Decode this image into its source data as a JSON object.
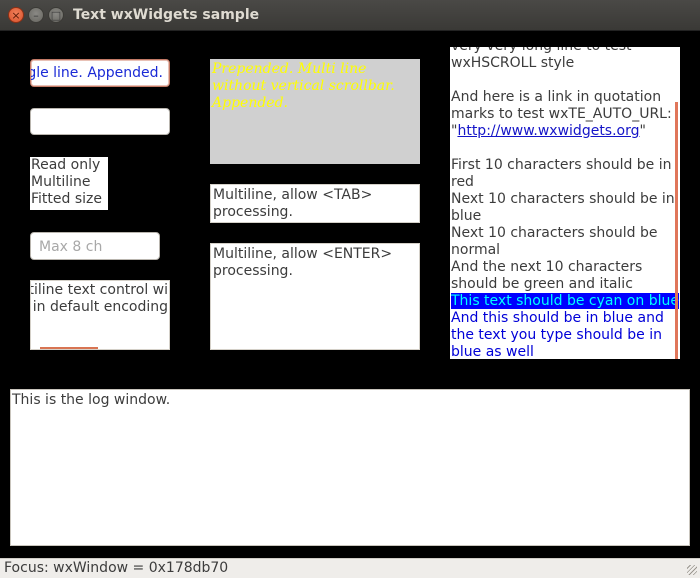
{
  "window": {
    "title": "Text wxWidgets sample",
    "close_glyph": "×",
    "min_glyph": "–",
    "max_glyph": "□"
  },
  "controls": {
    "single_line_text": "gle line. Appended.",
    "empty_value": "",
    "readonly_lines": [
      "Read only",
      "Multiline",
      "Fitted size"
    ],
    "maxlen_placeholder": "Max 8 ch",
    "encoding_lines": [
      "ltiline text control wi",
      "t in default encoding"
    ],
    "prepended_text": "Prepended. Multi line without vertical scrollbar. Appended.",
    "tab_text": "Multiline, allow <TAB> processing.",
    "enter_text": "Multiline, allow <ENTER> processing."
  },
  "rich": {
    "line0": "very very long line to test",
    "line1": "wxHSCROLL style",
    "link_intro": "And here is a link in quotation marks to test wxTE_AUTO_URL: \"",
    "link_text": "http://www.wxwidgets.org",
    "link_close": "\"",
    "red": "First 10 characters should be in red",
    "blue": "Next 10 characters should be in blue",
    "normal": "Next 10 characters should be normal",
    "green": "And the next 10 characters should be green and italic",
    "cyan": "This text should be cyan on blue",
    "final_blue": "And this should be in blue and the text you type should be in blue as well"
  },
  "log": {
    "text": "This is the log window."
  },
  "status": {
    "text": "Focus: wxWindow = 0x178db70"
  },
  "colors": {
    "accent": "#d87452",
    "link": "#1414c8",
    "cyan_fg": "#00ffff",
    "cyan_bg": "#0000ff",
    "prepended_bg": "#d0d0d0",
    "prepended_fg": "#ffff00"
  }
}
